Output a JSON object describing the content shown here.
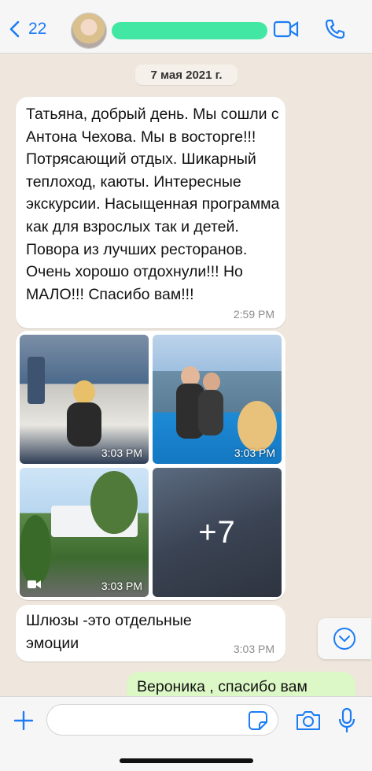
{
  "header": {
    "back_count": "22",
    "contact_name": ""
  },
  "chat": {
    "date_label": "7 мая 2021 г.",
    "messages": [
      {
        "text": "Татьяна, добрый день. Мы сошли с Антона Чехова. Мы в восторге!!! Потрясающий отдых. Шикарный теплоход, каюты. Интересные экскурсии. Насыщенная программа как для взрослых так и детей. Повора из лучших ресторанов. Очень хорошо отдохнули!!! Но МАЛО!!! Спасибо вам!!!",
        "time": "2:59 PM"
      }
    ],
    "media": {
      "tiles": [
        {
          "time": "3:03 PM"
        },
        {
          "time": "3:03 PM"
        },
        {
          "time": "3:03 PM",
          "has_video_icon": true
        },
        {
          "more_count": "+7"
        }
      ]
    },
    "message2": {
      "text": "Шлюзы -это отдельные эмоции",
      "time": "3:03 PM"
    },
    "outgoing": {
      "text": "Вероника , спасибо вам"
    }
  },
  "inputbar": {
    "placeholder": ""
  },
  "colors": {
    "accent": "#1b7cf5",
    "chat_bg": "#efe7dd",
    "outgoing_bubble": "#dcf8c6",
    "incoming_bubble": "#ffffff",
    "name_redaction": "#2fe59a"
  },
  "icons": [
    "chevron-left-icon",
    "video-call-icon",
    "phone-icon",
    "chevron-down-icon",
    "plus-icon",
    "sticker-icon",
    "camera-icon",
    "microphone-icon",
    "video-camera-icon"
  ]
}
